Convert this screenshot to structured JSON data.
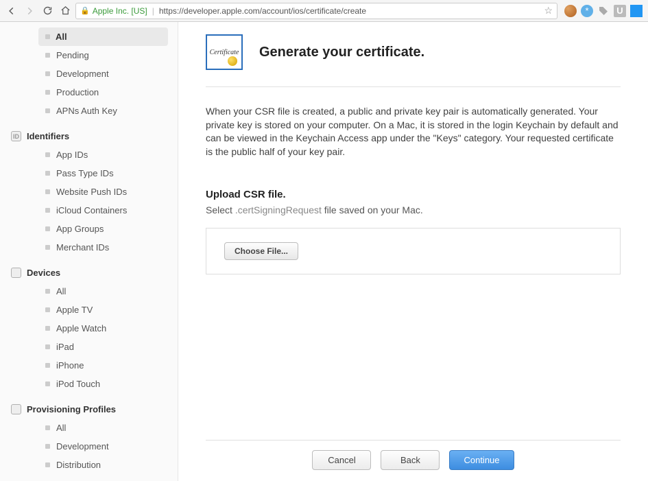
{
  "browser": {
    "org": "Apple Inc. [US]",
    "url": "https://developer.apple.com/account/ios/certificate/create"
  },
  "sidebar": {
    "certs": {
      "items": [
        "All",
        "Pending",
        "Development",
        "Production",
        "APNs Auth Key"
      ],
      "active": 0
    },
    "identifiers": {
      "label": "Identifiers",
      "items": [
        "App IDs",
        "Pass Type IDs",
        "Website Push IDs",
        "iCloud Containers",
        "App Groups",
        "Merchant IDs"
      ]
    },
    "devices": {
      "label": "Devices",
      "items": [
        "All",
        "Apple TV",
        "Apple Watch",
        "iPad",
        "iPhone",
        "iPod Touch"
      ]
    },
    "profiles": {
      "label": "Provisioning Profiles",
      "items": [
        "All",
        "Development",
        "Distribution"
      ]
    }
  },
  "main": {
    "badge_text": "Certificate",
    "title": "Generate your certificate.",
    "description": "When your CSR file is created, a public and private key pair is automatically generated. Your private key is stored on your computer. On a Mac, it is stored in the login Keychain by default and can be viewed in the Keychain Access app under the \"Keys\" category. Your requested certificate is the public half of your key pair.",
    "upload_heading": "Upload CSR file.",
    "upload_prefix": "Select ",
    "upload_filetype": ".certSigningRequest",
    "upload_suffix": " file saved on your Mac.",
    "choose_label": "Choose File..."
  },
  "footer": {
    "cancel": "Cancel",
    "back": "Back",
    "continue": "Continue"
  }
}
